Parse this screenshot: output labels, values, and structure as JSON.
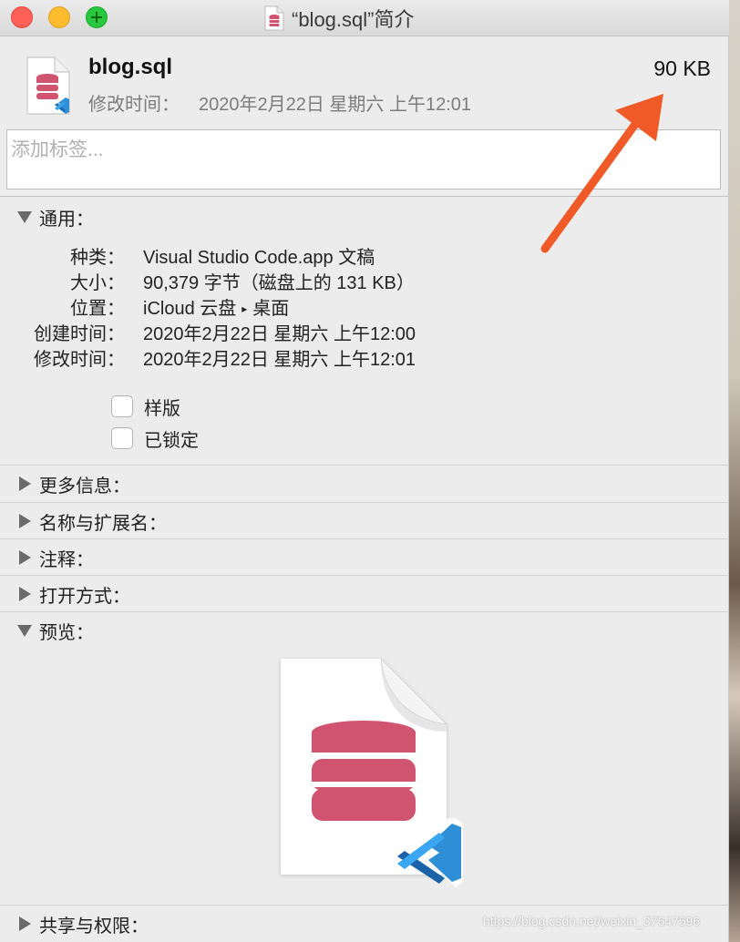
{
  "window": {
    "title": "“blog.sql”简介"
  },
  "header": {
    "filename": "blog.sql",
    "modified_label": "修改时间：",
    "modified_value": "2020年2月22日 星期六 上午12:01",
    "size": "90 KB"
  },
  "tags": {
    "placeholder": "添加标签..."
  },
  "general": {
    "title": "通用：",
    "rows": [
      {
        "key": "种类：",
        "value": "Visual Studio Code.app 文稿"
      },
      {
        "key": "大小：",
        "value": "90,379 字节（磁盘上的 131 KB）"
      },
      {
        "key": "位置：",
        "value_a": "iCloud 云盘",
        "value_b": "桌面"
      },
      {
        "key": "创建时间：",
        "value": "2020年2月22日 星期六 上午12:00"
      },
      {
        "key": "修改时间：",
        "value": "2020年2月22日 星期六 上午12:01"
      }
    ],
    "checkboxes": [
      {
        "label": "样版",
        "checked": false
      },
      {
        "label": "已锁定",
        "checked": false
      }
    ]
  },
  "sections": {
    "more_info": "更多信息：",
    "name_ext": "名称与扩展名：",
    "comments": "注释：",
    "open_with": "打开方式：",
    "preview": "预览：",
    "sharing": "共享与权限："
  },
  "watermark": "https://blog.csdn.net/weixin_37647596",
  "colors": {
    "db_icon": "#d0546f",
    "vscode_blue": "#2f8fd6",
    "annotation_arrow": "#f05a28"
  }
}
